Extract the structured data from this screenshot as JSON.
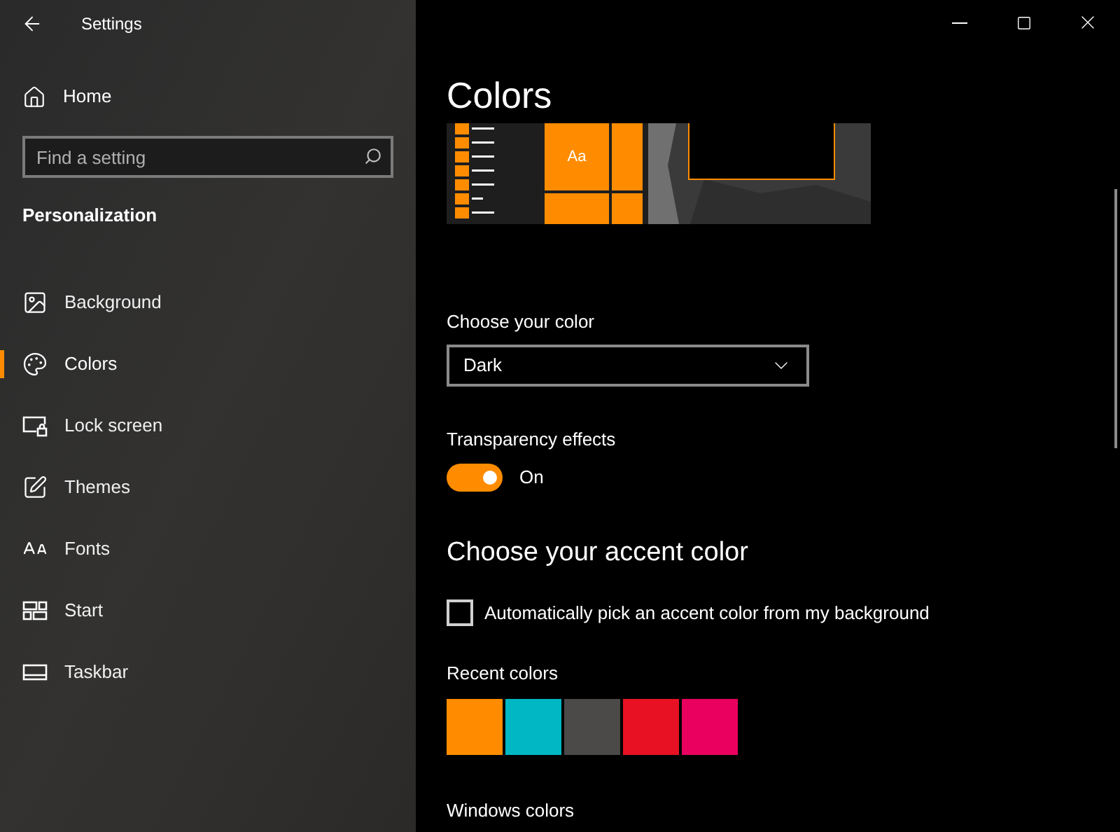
{
  "window": {
    "title": "Settings"
  },
  "sidebar": {
    "home": "Home",
    "search": {
      "placeholder": "Find a setting"
    },
    "section": "Personalization",
    "items": [
      {
        "label": "Background",
        "kind": "background",
        "selected": false
      },
      {
        "label": "Colors",
        "kind": "colors",
        "selected": true
      },
      {
        "label": "Lock screen",
        "kind": "lock",
        "selected": false
      },
      {
        "label": "Themes",
        "kind": "themes",
        "selected": false
      },
      {
        "label": "Fonts",
        "kind": "fonts",
        "selected": false
      },
      {
        "label": "Start",
        "kind": "start",
        "selected": false
      },
      {
        "label": "Taskbar",
        "kind": "taskbar",
        "selected": false
      }
    ]
  },
  "page": {
    "title": "Colors",
    "preview_tile": "Aa",
    "color_mode": {
      "label": "Choose your color",
      "value": "Dark"
    },
    "transparency": {
      "label": "Transparency effects",
      "on": true,
      "state_text": "On"
    },
    "accent_heading": "Choose your accent color",
    "auto_pick": {
      "label": "Automatically pick an accent color from my background",
      "checked": false
    },
    "recent": {
      "label": "Recent colors",
      "swatches": [
        {
          "color": "#ff8c00"
        },
        {
          "color": "#00b7c3"
        },
        {
          "color": "#4c4a48"
        },
        {
          "color": "#e81123"
        },
        {
          "color": "#ea005e"
        }
      ]
    },
    "windows_colors": {
      "label": "Windows colors"
    }
  }
}
